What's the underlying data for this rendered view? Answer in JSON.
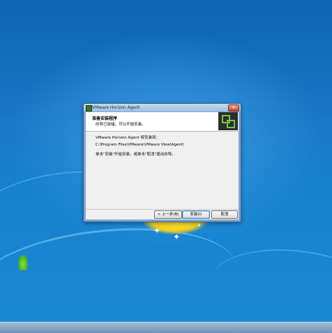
{
  "window": {
    "title": "VMware Horizon Agent",
    "close_label": "✕"
  },
  "header": {
    "title": "准备安装程序",
    "subtitle": "向导已就绪，可以开始安装。"
  },
  "body": {
    "line1": "VMware Horizon Agent 将安装到：",
    "install_path": "C:\\Program Files\\VMware\\VMware View\\Agent\\",
    "line3": "单击\"安装\"开始安装，或单击\"取消\"退出向导。"
  },
  "buttons": {
    "back": "< 上一步(B)",
    "install": "安装(I)",
    "cancel": "取消"
  },
  "colors": {
    "desktop": "#1a78c8",
    "accent_green": "#78c442"
  },
  "icons": {
    "app": "vmware-horizon-icon",
    "logo": "vmware-logo-icon"
  }
}
